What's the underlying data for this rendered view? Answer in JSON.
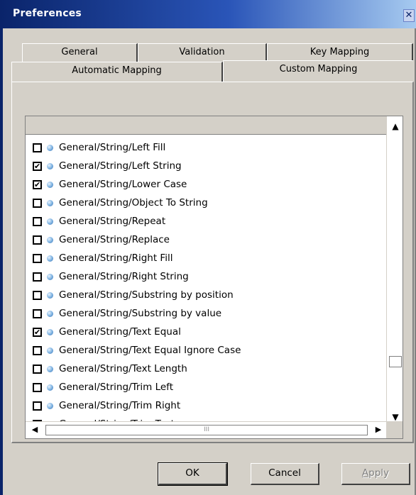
{
  "window": {
    "title": "Preferences",
    "close_glyph": "✕"
  },
  "tabs_row1": [
    {
      "label": "General"
    },
    {
      "label": "Validation"
    },
    {
      "label": "Key Mapping"
    }
  ],
  "tabs_row2": [
    {
      "label": "Automatic Mapping",
      "active": false
    },
    {
      "label": "Custom Mapping",
      "active": true
    }
  ],
  "list": {
    "items": [
      {
        "label": "General/String/Left Fill",
        "checked": false
      },
      {
        "label": "General/String/Left String",
        "checked": true
      },
      {
        "label": "General/String/Lower Case",
        "checked": true
      },
      {
        "label": "General/String/Object To String",
        "checked": false
      },
      {
        "label": "General/String/Repeat",
        "checked": false
      },
      {
        "label": "General/String/Replace",
        "checked": false
      },
      {
        "label": "General/String/Right Fill",
        "checked": false
      },
      {
        "label": "General/String/Right String",
        "checked": false
      },
      {
        "label": "General/String/Substring by position",
        "checked": false
      },
      {
        "label": "General/String/Substring by value",
        "checked": false
      },
      {
        "label": "General/String/Text Equal",
        "checked": true
      },
      {
        "label": "General/String/Text Equal Ignore Case",
        "checked": false
      },
      {
        "label": "General/String/Text Length",
        "checked": false
      },
      {
        "label": "General/String/Trim Left",
        "checked": false
      },
      {
        "label": "General/String/Trim Right",
        "checked": false
      },
      {
        "label": "General/String/Trim Text",
        "checked": false
      }
    ],
    "item_icon": "bullet-icon",
    "check_glyph": "✔"
  },
  "scroll": {
    "up": "▲",
    "down": "▼",
    "left": "◀",
    "right": "▶",
    "grip": "III"
  },
  "buttons": {
    "ok": "OK",
    "cancel": "Cancel",
    "apply_first": "A",
    "apply_rest": "pply"
  },
  "colors": {
    "title_start": "#0a246a",
    "title_end": "#a6caf0",
    "face": "#d4d0c8"
  }
}
